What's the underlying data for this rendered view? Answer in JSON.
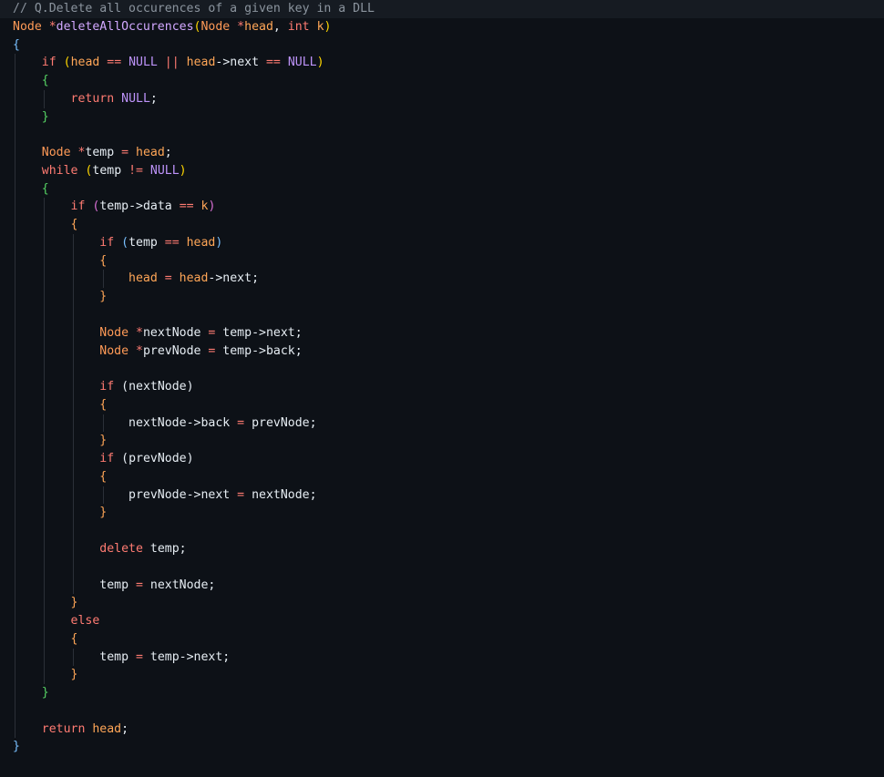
{
  "editor": {
    "language": "C++",
    "theme_colors": {
      "background": "#0d1117",
      "comment": "#8b949e",
      "keyword": "#ff7b72",
      "type": "#ff9a57",
      "function": "#d2a8ff",
      "constant": "#bd93f9",
      "text": "#e6edf3"
    },
    "lines": [
      {
        "indent": 0,
        "highlight": true,
        "tokens": [
          {
            "t": "// Q.Delete all occurences of a given key in a DLL",
            "c": "comment"
          }
        ]
      },
      {
        "indent": 0,
        "tokens": [
          {
            "t": "Node",
            "c": "type"
          },
          {
            "t": " *",
            "c": "op"
          },
          {
            "t": "deleteAllOccurences",
            "c": "func"
          },
          {
            "t": "(",
            "c": "b2"
          },
          {
            "t": "Node",
            "c": "type"
          },
          {
            "t": " *",
            "c": "op"
          },
          {
            "t": "head",
            "c": "param"
          },
          {
            "t": ", ",
            "c": "punct"
          },
          {
            "t": "int",
            "c": "kw"
          },
          {
            "t": " ",
            "c": "punct"
          },
          {
            "t": "k",
            "c": "param"
          },
          {
            "t": ")",
            "c": "b2"
          }
        ]
      },
      {
        "indent": 0,
        "tokens": [
          {
            "t": "{",
            "c": "b1"
          }
        ]
      },
      {
        "indent": 1,
        "tokens": [
          {
            "t": "if",
            "c": "kw"
          },
          {
            "t": " ",
            "c": "punct"
          },
          {
            "t": "(",
            "c": "b2"
          },
          {
            "t": "head",
            "c": "var"
          },
          {
            "t": " == ",
            "c": "op"
          },
          {
            "t": "NULL",
            "c": "const"
          },
          {
            "t": " || ",
            "c": "op"
          },
          {
            "t": "head",
            "c": "var"
          },
          {
            "t": "->",
            "c": "punct"
          },
          {
            "t": "next",
            "c": "ident"
          },
          {
            "t": " == ",
            "c": "op"
          },
          {
            "t": "NULL",
            "c": "const"
          },
          {
            "t": ")",
            "c": "b2"
          }
        ]
      },
      {
        "indent": 1,
        "tokens": [
          {
            "t": "{",
            "c": "brace_g"
          }
        ]
      },
      {
        "indent": 2,
        "tokens": [
          {
            "t": "return",
            "c": "kw"
          },
          {
            "t": " ",
            "c": "punct"
          },
          {
            "t": "NULL",
            "c": "const"
          },
          {
            "t": ";",
            "c": "punct"
          }
        ]
      },
      {
        "indent": 1,
        "tokens": [
          {
            "t": "}",
            "c": "brace_g"
          }
        ]
      },
      {
        "indent": 1,
        "tokens": []
      },
      {
        "indent": 1,
        "tokens": [
          {
            "t": "Node",
            "c": "type"
          },
          {
            "t": " *",
            "c": "op"
          },
          {
            "t": "temp",
            "c": "ident"
          },
          {
            "t": " = ",
            "c": "op"
          },
          {
            "t": "head",
            "c": "var"
          },
          {
            "t": ";",
            "c": "punct"
          }
        ]
      },
      {
        "indent": 1,
        "tokens": [
          {
            "t": "while",
            "c": "kw"
          },
          {
            "t": " ",
            "c": "punct"
          },
          {
            "t": "(",
            "c": "b2"
          },
          {
            "t": "temp",
            "c": "ident"
          },
          {
            "t": " != ",
            "c": "op"
          },
          {
            "t": "NULL",
            "c": "const"
          },
          {
            "t": ")",
            "c": "b2"
          }
        ]
      },
      {
        "indent": 1,
        "tokens": [
          {
            "t": "{",
            "c": "brace_g"
          }
        ]
      },
      {
        "indent": 2,
        "tokens": [
          {
            "t": "if",
            "c": "kw"
          },
          {
            "t": " ",
            "c": "punct"
          },
          {
            "t": "(",
            "c": "b3"
          },
          {
            "t": "temp",
            "c": "ident"
          },
          {
            "t": "->",
            "c": "punct"
          },
          {
            "t": "data",
            "c": "ident"
          },
          {
            "t": " == ",
            "c": "op"
          },
          {
            "t": "k",
            "c": "var"
          },
          {
            "t": ")",
            "c": "b3"
          }
        ]
      },
      {
        "indent": 2,
        "tokens": [
          {
            "t": "{",
            "c": "brace_o"
          }
        ]
      },
      {
        "indent": 3,
        "tokens": [
          {
            "t": "if",
            "c": "kw"
          },
          {
            "t": " ",
            "c": "punct"
          },
          {
            "t": "(",
            "c": "b1"
          },
          {
            "t": "temp",
            "c": "ident"
          },
          {
            "t": " == ",
            "c": "op"
          },
          {
            "t": "head",
            "c": "var"
          },
          {
            "t": ")",
            "c": "b1"
          }
        ]
      },
      {
        "indent": 3,
        "tokens": [
          {
            "t": "{",
            "c": "brace_o"
          }
        ]
      },
      {
        "indent": 4,
        "tokens": [
          {
            "t": "head",
            "c": "var"
          },
          {
            "t": " = ",
            "c": "op"
          },
          {
            "t": "head",
            "c": "var"
          },
          {
            "t": "->",
            "c": "punct"
          },
          {
            "t": "next",
            "c": "ident"
          },
          {
            "t": ";",
            "c": "punct"
          }
        ]
      },
      {
        "indent": 3,
        "tokens": [
          {
            "t": "}",
            "c": "brace_o"
          }
        ]
      },
      {
        "indent": 3,
        "tokens": []
      },
      {
        "indent": 3,
        "tokens": [
          {
            "t": "Node",
            "c": "type"
          },
          {
            "t": " *",
            "c": "op"
          },
          {
            "t": "nextNode",
            "c": "ident"
          },
          {
            "t": " = ",
            "c": "op"
          },
          {
            "t": "temp",
            "c": "ident"
          },
          {
            "t": "->",
            "c": "punct"
          },
          {
            "t": "next",
            "c": "ident"
          },
          {
            "t": ";",
            "c": "punct"
          }
        ]
      },
      {
        "indent": 3,
        "tokens": [
          {
            "t": "Node",
            "c": "type"
          },
          {
            "t": " *",
            "c": "op"
          },
          {
            "t": "prevNode",
            "c": "ident"
          },
          {
            "t": " = ",
            "c": "op"
          },
          {
            "t": "temp",
            "c": "ident"
          },
          {
            "t": "->",
            "c": "punct"
          },
          {
            "t": "back",
            "c": "ident"
          },
          {
            "t": ";",
            "c": "punct"
          }
        ]
      },
      {
        "indent": 3,
        "tokens": []
      },
      {
        "indent": 3,
        "tokens": [
          {
            "t": "if",
            "c": "kw"
          },
          {
            "t": " ",
            "c": "punct"
          },
          {
            "t": "(",
            "c": "punct"
          },
          {
            "t": "nextNode",
            "c": "ident"
          },
          {
            "t": ")",
            "c": "punct"
          }
        ]
      },
      {
        "indent": 3,
        "tokens": [
          {
            "t": "{",
            "c": "brace_o"
          }
        ]
      },
      {
        "indent": 4,
        "tokens": [
          {
            "t": "nextNode",
            "c": "ident"
          },
          {
            "t": "->",
            "c": "punct"
          },
          {
            "t": "back",
            "c": "ident"
          },
          {
            "t": " = ",
            "c": "op"
          },
          {
            "t": "prevNode",
            "c": "ident"
          },
          {
            "t": ";",
            "c": "punct"
          }
        ]
      },
      {
        "indent": 3,
        "tokens": [
          {
            "t": "}",
            "c": "brace_o"
          }
        ]
      },
      {
        "indent": 3,
        "tokens": [
          {
            "t": "if",
            "c": "kw"
          },
          {
            "t": " ",
            "c": "punct"
          },
          {
            "t": "(",
            "c": "punct"
          },
          {
            "t": "prevNode",
            "c": "ident"
          },
          {
            "t": ")",
            "c": "punct"
          }
        ]
      },
      {
        "indent": 3,
        "tokens": [
          {
            "t": "{",
            "c": "brace_o"
          }
        ]
      },
      {
        "indent": 4,
        "tokens": [
          {
            "t": "prevNode",
            "c": "ident"
          },
          {
            "t": "->",
            "c": "punct"
          },
          {
            "t": "next",
            "c": "ident"
          },
          {
            "t": " = ",
            "c": "op"
          },
          {
            "t": "nextNode",
            "c": "ident"
          },
          {
            "t": ";",
            "c": "punct"
          }
        ]
      },
      {
        "indent": 3,
        "tokens": [
          {
            "t": "}",
            "c": "brace_o"
          }
        ]
      },
      {
        "indent": 3,
        "tokens": []
      },
      {
        "indent": 3,
        "tokens": [
          {
            "t": "delete",
            "c": "kw"
          },
          {
            "t": " ",
            "c": "punct"
          },
          {
            "t": "temp",
            "c": "ident"
          },
          {
            "t": ";",
            "c": "punct"
          }
        ]
      },
      {
        "indent": 3,
        "tokens": []
      },
      {
        "indent": 3,
        "tokens": [
          {
            "t": "temp",
            "c": "ident"
          },
          {
            "t": " = ",
            "c": "op"
          },
          {
            "t": "nextNode",
            "c": "ident"
          },
          {
            "t": ";",
            "c": "punct"
          }
        ]
      },
      {
        "indent": 2,
        "tokens": [
          {
            "t": "}",
            "c": "brace_o"
          }
        ]
      },
      {
        "indent": 2,
        "tokens": [
          {
            "t": "else",
            "c": "kw"
          }
        ]
      },
      {
        "indent": 2,
        "tokens": [
          {
            "t": "{",
            "c": "brace_o"
          }
        ]
      },
      {
        "indent": 3,
        "tokens": [
          {
            "t": "temp",
            "c": "ident"
          },
          {
            "t": " = ",
            "c": "op"
          },
          {
            "t": "temp",
            "c": "ident"
          },
          {
            "t": "->",
            "c": "punct"
          },
          {
            "t": "next",
            "c": "ident"
          },
          {
            "t": ";",
            "c": "punct"
          }
        ]
      },
      {
        "indent": 2,
        "tokens": [
          {
            "t": "}",
            "c": "brace_o"
          }
        ]
      },
      {
        "indent": 1,
        "tokens": [
          {
            "t": "}",
            "c": "brace_g"
          }
        ]
      },
      {
        "indent": 1,
        "tokens": []
      },
      {
        "indent": 1,
        "tokens": [
          {
            "t": "return",
            "c": "kw"
          },
          {
            "t": " ",
            "c": "punct"
          },
          {
            "t": "head",
            "c": "var"
          },
          {
            "t": ";",
            "c": "punct"
          }
        ]
      },
      {
        "indent": 0,
        "tokens": [
          {
            "t": "}",
            "c": "b1"
          }
        ]
      }
    ]
  }
}
